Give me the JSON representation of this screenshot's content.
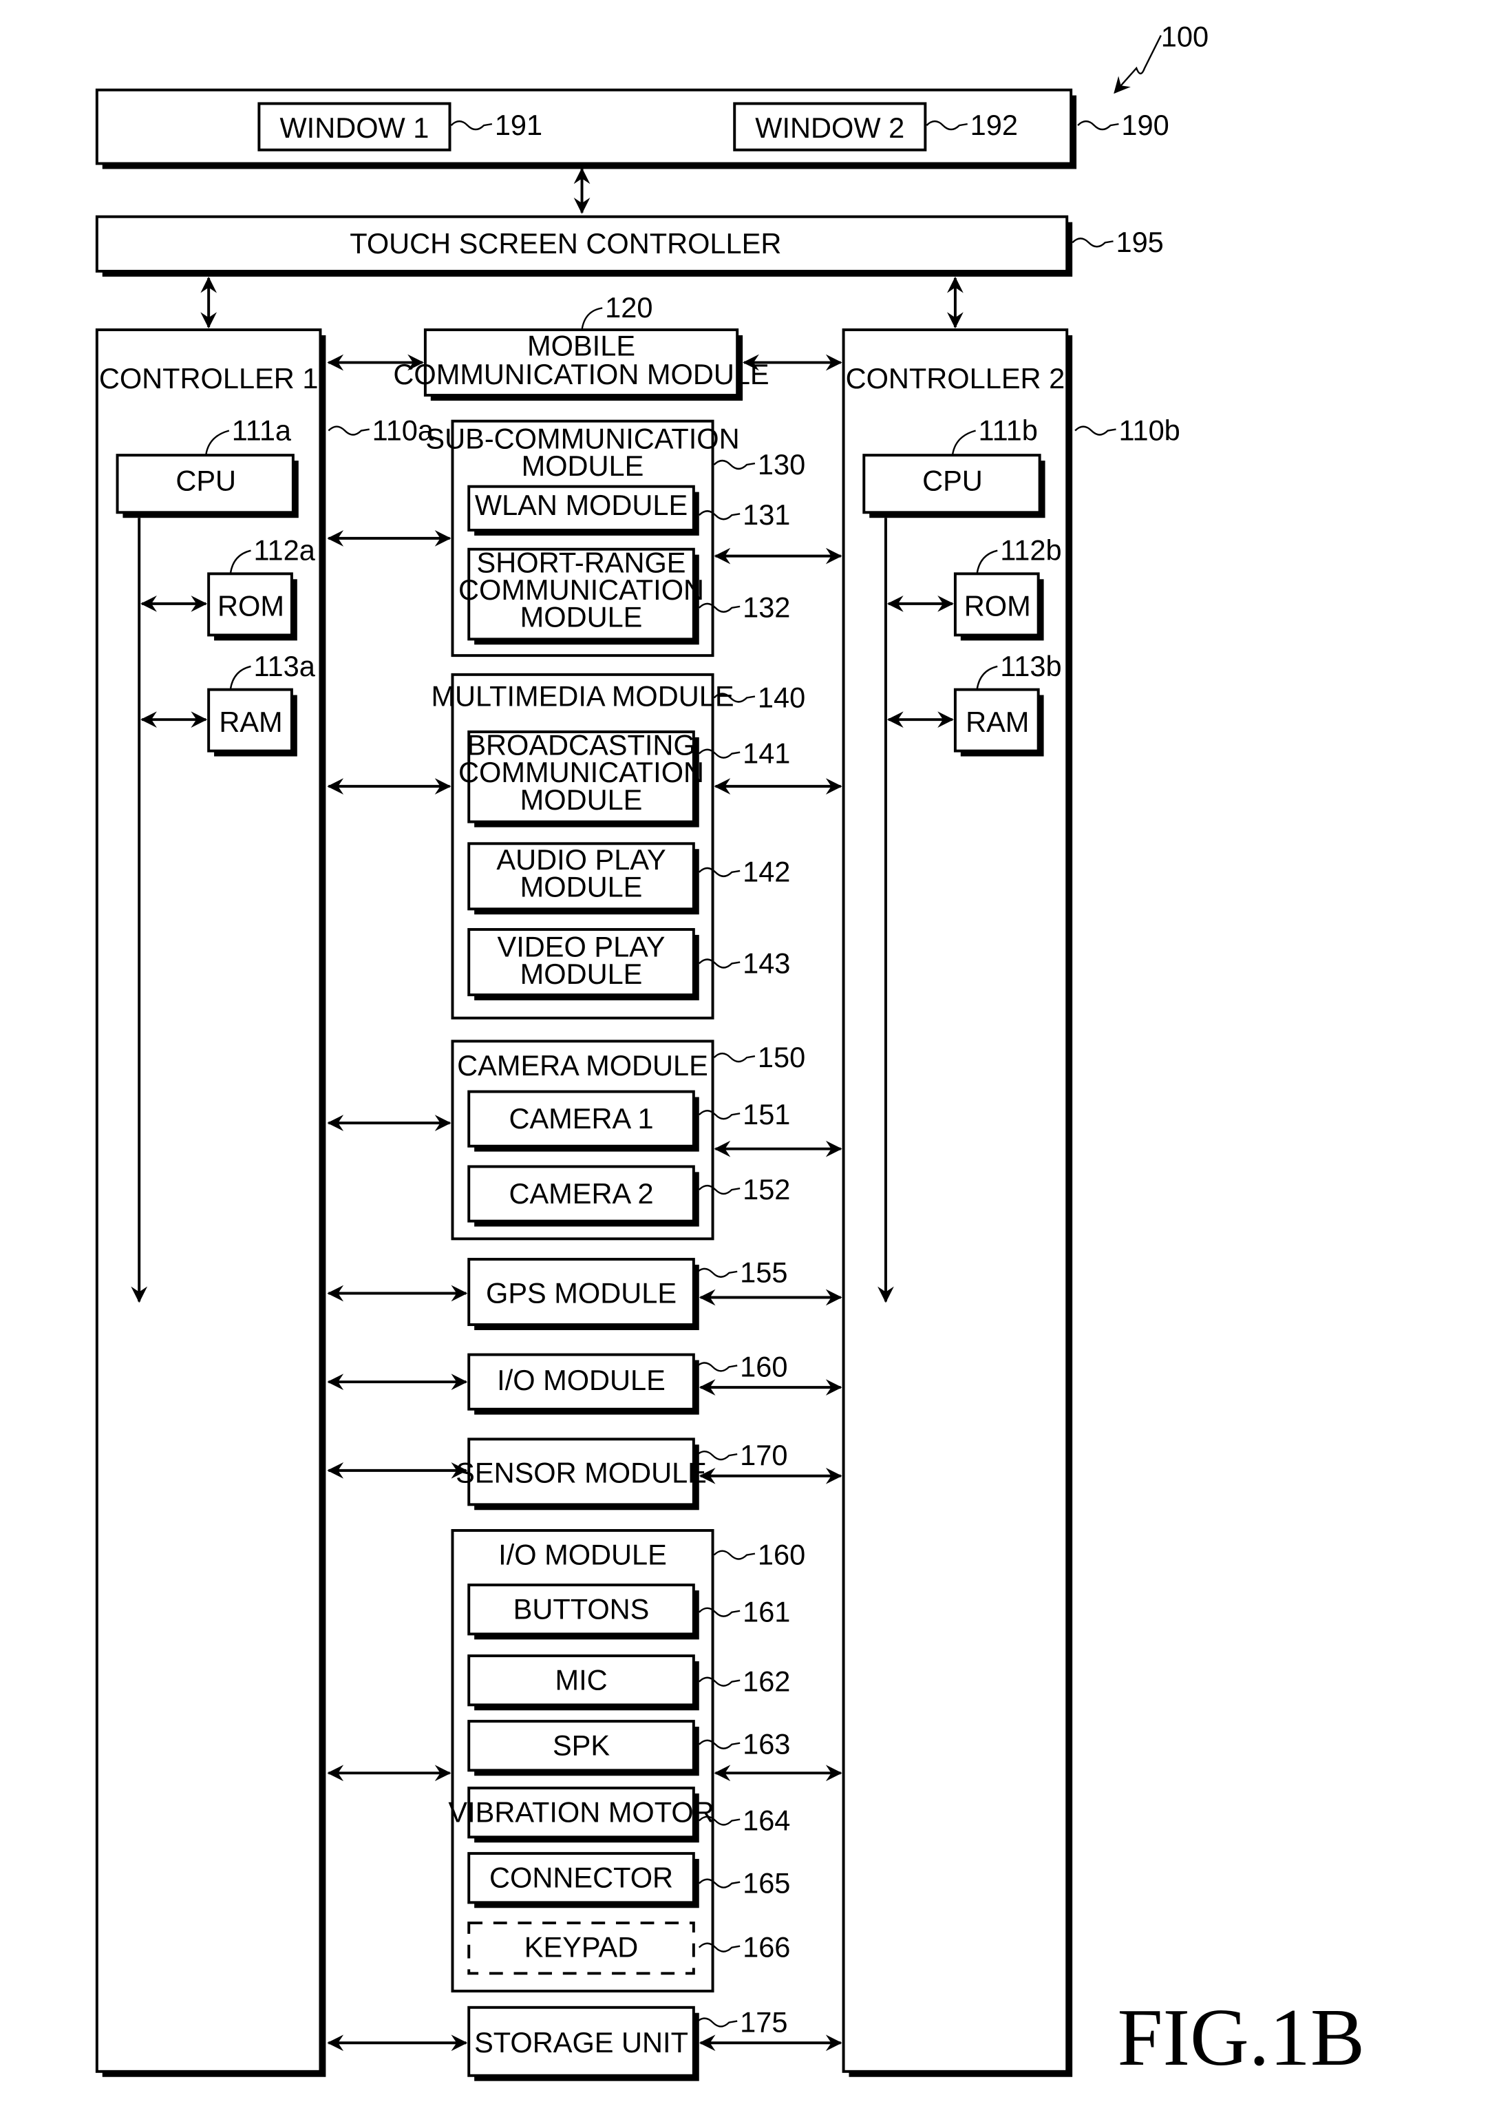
{
  "figure": {
    "label": "FIG.1B",
    "device_ref": "100"
  },
  "touch_screen": {
    "ref": "190",
    "windows": [
      {
        "label": "WINDOW 1",
        "ref": "191"
      },
      {
        "label": "WINDOW 2",
        "ref": "192"
      }
    ]
  },
  "touch_screen_controller": {
    "label": "TOUCH SCREEN CONTROLLER",
    "ref": "195"
  },
  "controllers": [
    {
      "label": "CONTROLLER 1",
      "ref": "110a",
      "cpu": {
        "label": "CPU",
        "ref": "111a"
      },
      "rom": {
        "label": "ROM",
        "ref": "112a"
      },
      "ram": {
        "label": "RAM",
        "ref": "113a"
      }
    },
    {
      "label": "CONTROLLER 2",
      "ref": "110b",
      "cpu": {
        "label": "CPU",
        "ref": "111b"
      },
      "rom": {
        "label": "ROM",
        "ref": "112b"
      },
      "ram": {
        "label": "RAM",
        "ref": "113b"
      }
    }
  ],
  "modules": {
    "mobile_comm": {
      "label_lines": [
        "MOBILE",
        "COMMUNICATION MODULE"
      ],
      "ref": "120"
    },
    "sub_comm": {
      "label_lines": [
        "SUB-COMMUNICATION",
        "MODULE"
      ],
      "ref": "130",
      "children": [
        {
          "label_lines": [
            "WLAN MODULE"
          ],
          "ref": "131"
        },
        {
          "label_lines": [
            "SHORT-RANGE",
            "COMMUNICATION",
            "MODULE"
          ],
          "ref": "132"
        }
      ]
    },
    "multimedia": {
      "label_lines": [
        "MULTIMEDIA MODULE"
      ],
      "ref": "140",
      "children": [
        {
          "label_lines": [
            "BROADCASTING",
            "COMMUNICATION",
            "MODULE"
          ],
          "ref": "141"
        },
        {
          "label_lines": [
            "AUDIO PLAY",
            "MODULE"
          ],
          "ref": "142"
        },
        {
          "label_lines": [
            "VIDEO PLAY",
            "MODULE"
          ],
          "ref": "143"
        }
      ]
    },
    "camera": {
      "label_lines": [
        "CAMERA MODULE"
      ],
      "ref": "150",
      "children": [
        {
          "label_lines": [
            "CAMERA 1"
          ],
          "ref": "151"
        },
        {
          "label_lines": [
            "CAMERA 2"
          ],
          "ref": "152"
        }
      ]
    },
    "gps": {
      "label_lines": [
        "GPS MODULE"
      ],
      "ref": "155"
    },
    "io_simple": {
      "label_lines": [
        "I/O MODULE"
      ],
      "ref": "160"
    },
    "sensor": {
      "label_lines": [
        "SENSOR MODULE"
      ],
      "ref": "170"
    },
    "io_group": {
      "label_lines": [
        "I/O MODULE"
      ],
      "ref": "160",
      "children": [
        {
          "label_lines": [
            "BUTTONS"
          ],
          "ref": "161"
        },
        {
          "label_lines": [
            "MIC"
          ],
          "ref": "162"
        },
        {
          "label_lines": [
            "SPK"
          ],
          "ref": "163"
        },
        {
          "label_lines": [
            "VIBRATION MOTOR"
          ],
          "ref": "164"
        },
        {
          "label_lines": [
            "CONNECTOR"
          ],
          "ref": "165"
        },
        {
          "label_lines": [
            "KEYPAD"
          ],
          "ref": "166",
          "optional": true
        }
      ]
    },
    "storage": {
      "label_lines": [
        "STORAGE UNIT"
      ],
      "ref": "175"
    }
  }
}
